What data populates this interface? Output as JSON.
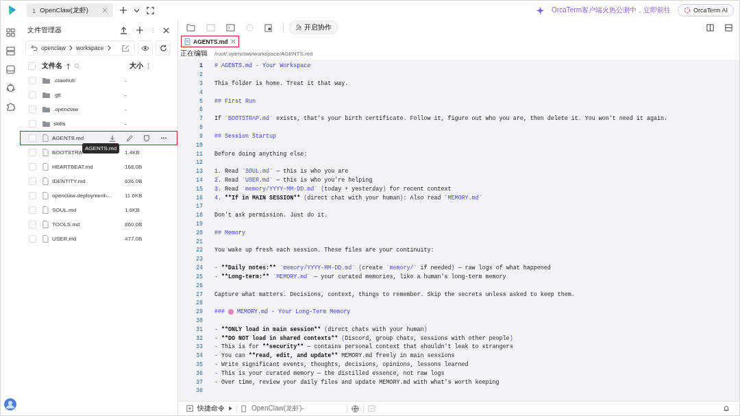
{
  "topbar": {
    "tab": {
      "index": "1",
      "title": "OpenClaw(龙虾)",
      "selected": true
    },
    "promo": "OrcaTerm客户端火热公测中，立即前往",
    "ai_button": "OrcaTerm AI"
  },
  "file_manager": {
    "title": "文件管理器",
    "breadcrumb": [
      "openclaw",
      "workspace"
    ],
    "columns": {
      "name": "文件名",
      "size": "大小"
    },
    "all_checked": false,
    "tooltip": "AGENTS.md",
    "files": [
      {
        "name": ".clawhub",
        "size": "-",
        "kind": "folder",
        "selected": false,
        "checked": false
      },
      {
        "name": ".git",
        "size": "-",
        "kind": "folder",
        "selected": false,
        "checked": false
      },
      {
        "name": ".openclaw",
        "size": "-",
        "kind": "folder",
        "selected": false,
        "checked": false
      },
      {
        "name": "skills",
        "size": "-",
        "kind": "folder",
        "selected": false,
        "checked": false
      },
      {
        "name": "AGENTS.md",
        "kind": "file",
        "selected": true,
        "checked": false
      },
      {
        "name": "BOOTSTRA",
        "size": "1.4KB",
        "kind": "file",
        "selected": false,
        "checked": false
      },
      {
        "name": "HEARTBEAT.md",
        "size": "168.0B",
        "kind": "file",
        "selected": false,
        "checked": false
      },
      {
        "name": "IDENTITY.md",
        "size": "636.0B",
        "kind": "file",
        "selected": false,
        "checked": false
      },
      {
        "name": "openclaw-deployment-...",
        "size": "11.6KB",
        "kind": "file",
        "selected": false,
        "checked": false
      },
      {
        "name": "SOUL.md",
        "size": "1.6KB",
        "kind": "file",
        "selected": false,
        "checked": false
      },
      {
        "name": "TOOLS.md",
        "size": "860.0B",
        "kind": "file",
        "selected": false,
        "checked": false
      },
      {
        "name": "USER.md",
        "size": "477.0B",
        "kind": "file",
        "selected": false,
        "checked": false
      }
    ]
  },
  "editor": {
    "collab_button": "开启协作",
    "tab": {
      "title": "AGENTS.md",
      "selected": true
    },
    "editing_label": "正在编辑",
    "path": "/root/.openclaw/workspace/AGENTS.md",
    "lines": [
      {
        "n": "1",
        "segs": [
          {
            "kind": "h",
            "text": "# AGENTS.md - Your Workspace"
          }
        ]
      },
      {
        "n": "2"
      },
      {
        "n": "3",
        "segs": [
          {
            "kind": "t",
            "text": "This folder is home. Treat it that way."
          }
        ]
      },
      {
        "n": "4"
      },
      {
        "n": "5",
        "segs": [
          {
            "kind": "h",
            "text": "## First Run"
          }
        ]
      },
      {
        "n": "6"
      },
      {
        "n": "7",
        "segs": [
          {
            "kind": "t",
            "text": "If `"
          },
          {
            "kind": "c",
            "text": "BOOTSTRAP.md"
          },
          {
            "kind": "t",
            "text": "` exists, that's your birth certificate. Follow it, figure out who you are, then delete it. You won't need it again."
          }
        ]
      },
      {
        "n": "8"
      },
      {
        "n": "9",
        "segs": [
          {
            "kind": "h",
            "text": "## Session Startup"
          }
        ]
      },
      {
        "n": "10"
      },
      {
        "n": "11",
        "segs": [
          {
            "kind": "t",
            "text": "Before doing anything else:"
          }
        ]
      },
      {
        "n": "12"
      },
      {
        "n": "13",
        "segs": [
          {
            "kind": "m",
            "text": "1."
          },
          {
            "kind": "t",
            "text": " Read `"
          },
          {
            "kind": "c",
            "text": "SOUL.md"
          },
          {
            "kind": "t",
            "text": "` — this is who you are"
          }
        ]
      },
      {
        "n": "14",
        "segs": [
          {
            "kind": "m",
            "text": "2."
          },
          {
            "kind": "t",
            "text": " Read `"
          },
          {
            "kind": "c",
            "text": "USER.md"
          },
          {
            "kind": "t",
            "text": "` — this is who you're helping"
          }
        ]
      },
      {
        "n": "15",
        "segs": [
          {
            "kind": "m",
            "text": "3."
          },
          {
            "kind": "t",
            "text": " Read `"
          },
          {
            "kind": "c",
            "text": "memory/YYYY-MM-DD.md"
          },
          {
            "kind": "t",
            "text": "` "
          },
          {
            "kind": "p",
            "text": "("
          },
          {
            "kind": "t",
            "text": "today + yesterday"
          },
          {
            "kind": "p",
            "text": ")"
          },
          {
            "kind": "t",
            "text": " for recent context"
          }
        ]
      },
      {
        "n": "16",
        "segs": [
          {
            "kind": "m",
            "text": "4. "
          },
          {
            "kind": "b",
            "text": "**If in MAIN SESSION**"
          },
          {
            "kind": "p",
            "text": " ("
          },
          {
            "kind": "t",
            "text": "direct chat with your human"
          },
          {
            "kind": "p",
            "text": ")"
          },
          {
            "kind": "t",
            "text": ": Also read `"
          },
          {
            "kind": "c",
            "text": "MEMORY.md"
          },
          {
            "kind": "t",
            "text": "`"
          }
        ]
      },
      {
        "n": "17"
      },
      {
        "n": "18",
        "segs": [
          {
            "kind": "t",
            "text": "Don't ask permission. Just do it."
          }
        ]
      },
      {
        "n": "19"
      },
      {
        "n": "20",
        "segs": [
          {
            "kind": "h",
            "text": "## Memory"
          }
        ]
      },
      {
        "n": "21"
      },
      {
        "n": "22",
        "segs": [
          {
            "kind": "t",
            "text": "You wake up fresh each session. These files are your continuity:"
          }
        ]
      },
      {
        "n": "23"
      },
      {
        "n": "24",
        "segs": [
          {
            "kind": "m",
            "text": "- "
          },
          {
            "kind": "b",
            "text": "**Daily notes:**"
          },
          {
            "kind": "t",
            "text": " `"
          },
          {
            "kind": "c",
            "text": "memory/YYYY-MM-DD.md"
          },
          {
            "kind": "t",
            "text": "` "
          },
          {
            "kind": "p",
            "text": "("
          },
          {
            "kind": "t",
            "text": "create `"
          },
          {
            "kind": "c",
            "text": "memory/"
          },
          {
            "kind": "t",
            "text": "` if needed"
          },
          {
            "kind": "p",
            "text": ")"
          },
          {
            "kind": "t",
            "text": " — raw logs of what happened"
          }
        ]
      },
      {
        "n": "25",
        "segs": [
          {
            "kind": "m",
            "text": "- "
          },
          {
            "kind": "b",
            "text": "**Long-term:**"
          },
          {
            "kind": "t",
            "text": " `"
          },
          {
            "kind": "c",
            "text": "MEMORY.md"
          },
          {
            "kind": "t",
            "text": "` — your curated memories, like a human's long-term memory"
          }
        ]
      },
      {
        "n": "26"
      },
      {
        "n": "27",
        "segs": [
          {
            "kind": "t",
            "text": "Capture what matters. Decisions, context, things to remember. Skip the secrets unless asked to keep them."
          }
        ]
      },
      {
        "n": "28"
      },
      {
        "n": "29",
        "segs": [
          {
            "kind": "h",
            "text": "###"
          },
          {
            "kind": "emoji"
          },
          {
            "kind": "h",
            "text": "MEMORY.md - Your Long-Term Memory"
          }
        ]
      },
      {
        "n": "30"
      },
      {
        "n": "31",
        "segs": [
          {
            "kind": "m",
            "text": "- "
          },
          {
            "kind": "b",
            "text": "**ONLY load in main session**"
          },
          {
            "kind": "p",
            "text": " ("
          },
          {
            "kind": "t",
            "text": "direct chats with your human"
          },
          {
            "kind": "p",
            "text": ")"
          }
        ]
      },
      {
        "n": "32",
        "segs": [
          {
            "kind": "m",
            "text": "- "
          },
          {
            "kind": "b",
            "text": "**DO NOT load in shared contexts**"
          },
          {
            "kind": "p",
            "text": " ("
          },
          {
            "kind": "t",
            "text": "Discord, group chats, sessions with other people"
          },
          {
            "kind": "p",
            "text": ")"
          }
        ]
      },
      {
        "n": "33",
        "segs": [
          {
            "kind": "m",
            "text": "-"
          },
          {
            "kind": "t",
            "text": " This is for "
          },
          {
            "kind": "b",
            "text": "**security**"
          },
          {
            "kind": "t",
            "text": " — contains personal context that shouldn't leak to strangers"
          }
        ]
      },
      {
        "n": "34",
        "segs": [
          {
            "kind": "m",
            "text": "-"
          },
          {
            "kind": "t",
            "text": " You can "
          },
          {
            "kind": "b",
            "text": "**read, edit, and update**"
          },
          {
            "kind": "t",
            "text": " MEMORY.md freely in main sessions"
          }
        ]
      },
      {
        "n": "35",
        "segs": [
          {
            "kind": "m",
            "text": "-"
          },
          {
            "kind": "t",
            "text": " Write significant events, thoughts, decisions, opinions, lessons learned"
          }
        ]
      },
      {
        "n": "36",
        "segs": [
          {
            "kind": "m",
            "text": "-"
          },
          {
            "kind": "t",
            "text": " This is your curated memory — the distilled essence, not raw logs"
          }
        ]
      },
      {
        "n": "37",
        "segs": [
          {
            "kind": "m",
            "text": "-"
          },
          {
            "kind": "t",
            "text": " Over time, review your daily files and update MEMORY.md with what's worth keeping"
          }
        ]
      },
      {
        "n": "38"
      }
    ]
  },
  "status_bar": {
    "quick_commands": "快捷命令",
    "session": "OpenClaw(龙虾)-"
  }
}
